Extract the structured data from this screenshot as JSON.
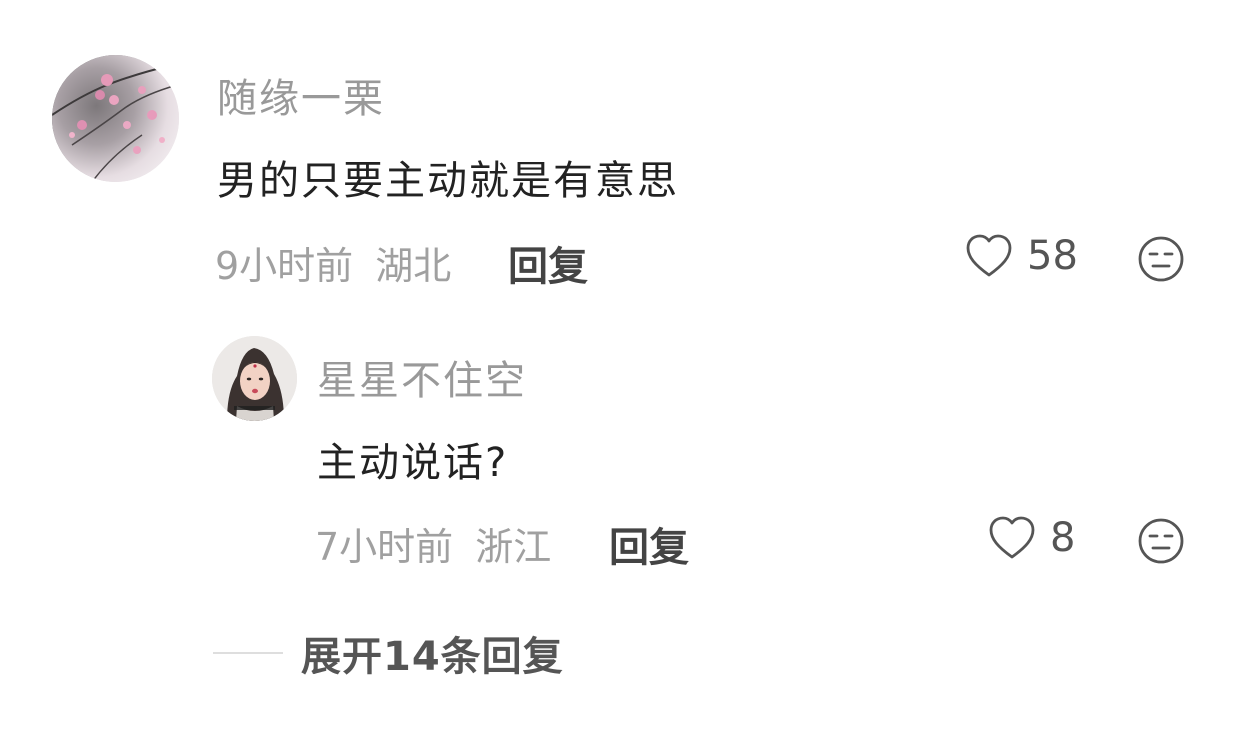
{
  "comment": {
    "username": "随缘一栗",
    "text": "男的只要主动就是有意思",
    "time": "9小时前",
    "location": "湖北",
    "reply_label": "回复",
    "likes": "58",
    "avatar_icon": "plum-blossom-avatar"
  },
  "reply": {
    "username": "星星不住空",
    "text": "主动说话?",
    "time": "7小时前",
    "location": "浙江",
    "reply_label": "回复",
    "likes": "8",
    "avatar_icon": "woman-portrait-avatar"
  },
  "expand_label": "展开14条回复",
  "colors": {
    "username": "#999999",
    "text": "#222222",
    "meta": "#a0a0a0",
    "icon": "#555555"
  }
}
